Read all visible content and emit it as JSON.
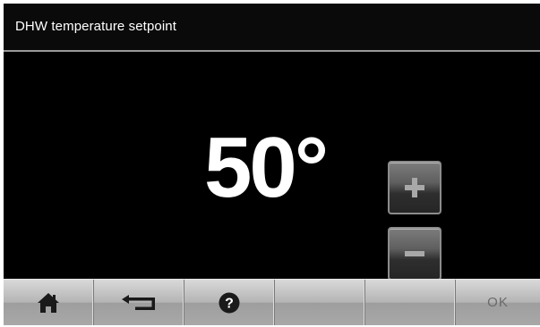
{
  "header": {
    "title": "DHW temperature setpoint"
  },
  "setpoint": {
    "value": "50°"
  },
  "controls": {
    "increase_icon": "plus-icon",
    "decrease_icon": "minus-icon"
  },
  "toolbar": {
    "buttons": [
      {
        "icon": "home-icon",
        "label": ""
      },
      {
        "icon": "back-arrow-icon",
        "label": ""
      },
      {
        "icon": "help-icon",
        "label": ""
      },
      {
        "icon": "",
        "label": ""
      },
      {
        "icon": "",
        "label": ""
      },
      {
        "icon": "",
        "label": "OK"
      }
    ]
  },
  "colors": {
    "background": "#000000",
    "text": "#ffffff",
    "divider": "#9a9a9a",
    "toolbar_light": "#d9d9d9",
    "toolbar_dark": "#9e9e9e",
    "disabled_text": "#6a6a6a"
  }
}
